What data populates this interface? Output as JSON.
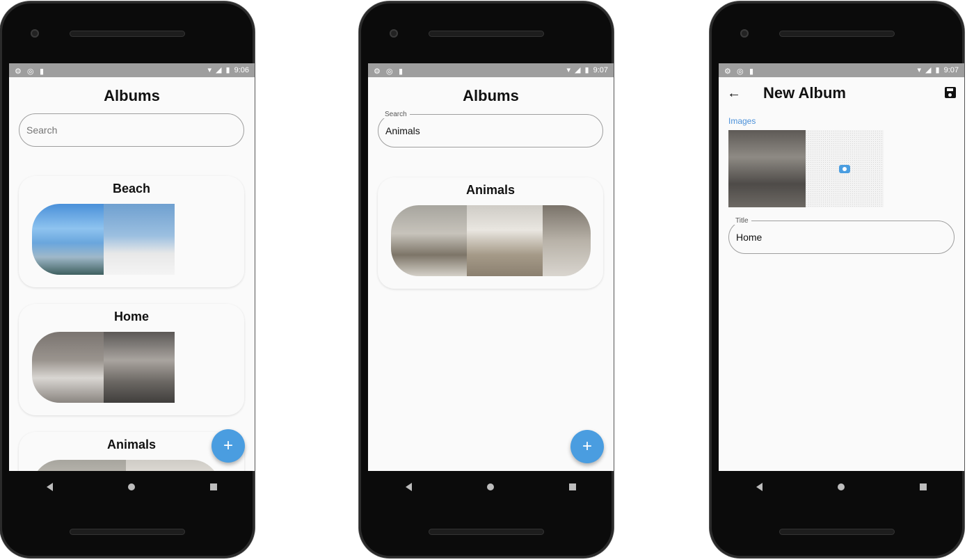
{
  "colors": {
    "accent": "#4a9de0",
    "status_bar": "#9e9e9e",
    "screen_bg": "#fafafa"
  },
  "screens": [
    {
      "status_time": "9:06",
      "title": "Albums",
      "search": {
        "label": "",
        "value": "",
        "placeholder": "Search"
      },
      "albums": [
        {
          "title": "Beach"
        },
        {
          "title": "Home"
        },
        {
          "title": "Animals"
        }
      ],
      "fab": "+"
    },
    {
      "status_time": "9:07",
      "title": "Albums",
      "search": {
        "label": "Search",
        "value": "Animals",
        "placeholder": ""
      },
      "albums": [
        {
          "title": "Animals"
        }
      ],
      "fab": "+"
    },
    {
      "status_time": "9:07",
      "title": "New Album",
      "back_icon": "arrow-back-icon",
      "save_icon": "save-icon",
      "images_label": "Images",
      "camera_icon": "camera-icon",
      "title_field": {
        "label": "Title",
        "value": "Home"
      }
    }
  ]
}
